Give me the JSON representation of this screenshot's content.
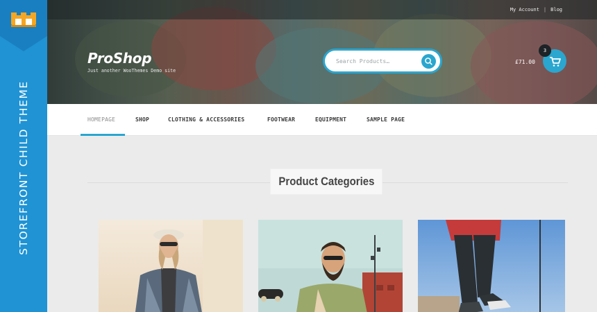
{
  "side_badge": {
    "label": "STOREFRONT CHILD THEME",
    "color": "#1f93d4"
  },
  "header": {
    "top_links": [
      "My Account",
      "Blog"
    ],
    "separator": "|",
    "site_title": "ProShop",
    "tagline": "Just another WooThemes Demo site",
    "search": {
      "placeholder": "Search Products…",
      "icon": "search-icon"
    },
    "cart": {
      "total": "£71.00",
      "count": "3",
      "icon": "cart-icon"
    },
    "accent": "#2aa6cf"
  },
  "nav": {
    "items": [
      {
        "label": "HOMEPAGE",
        "active": true
      },
      {
        "label": "SHOP"
      },
      {
        "label": "CLOTHING & ACCESSORIES"
      },
      {
        "label": "FOOTWEAR"
      },
      {
        "label": "EQUIPMENT"
      },
      {
        "label": "SAMPLE PAGE"
      }
    ]
  },
  "main": {
    "section_title": "Product Categories",
    "category_cards": [
      {
        "image": "woman-in-plaid-shirt-photo"
      },
      {
        "image": "bearded-man-with-skateboard-photo"
      },
      {
        "image": "skater-legs-photo"
      }
    ]
  }
}
